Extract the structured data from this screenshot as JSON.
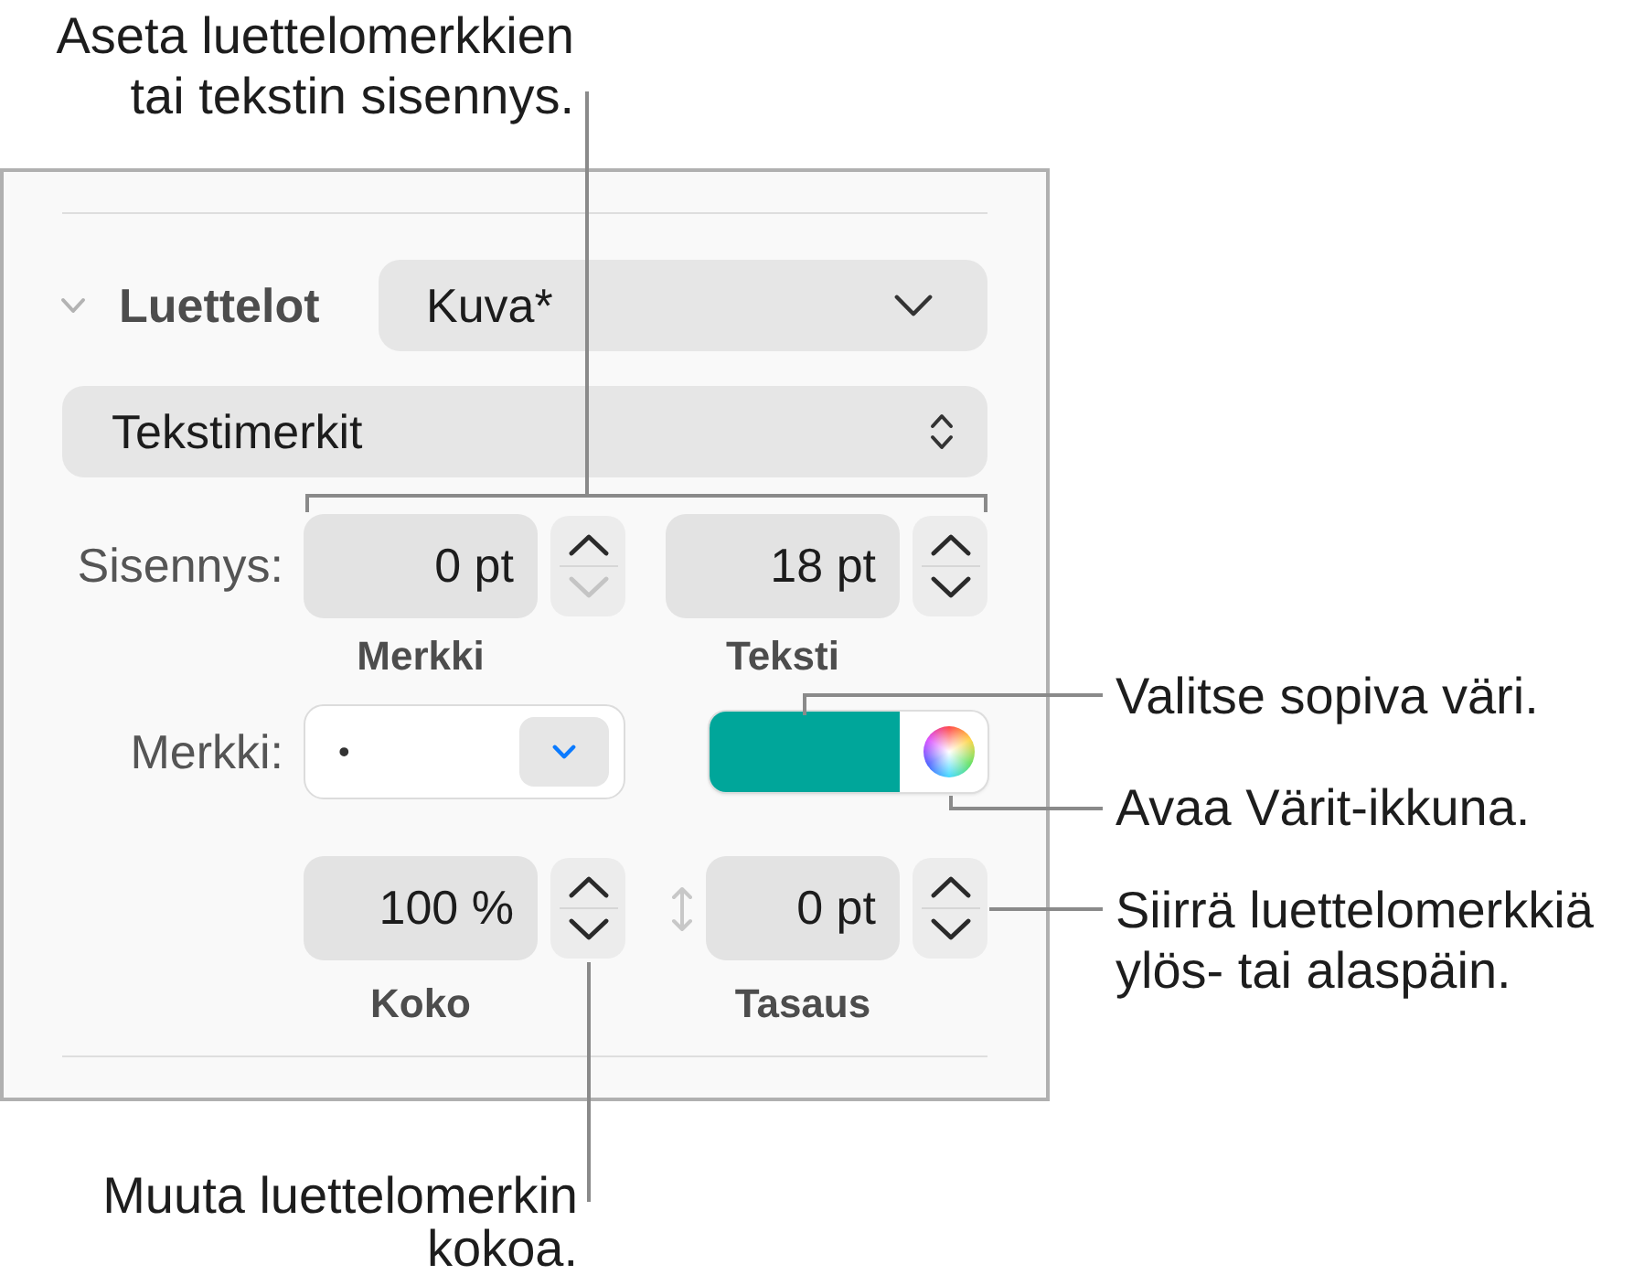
{
  "callouts": [
    {
      "text": "Aseta luettelomerkkien\ntai tekstin sisennys."
    },
    {
      "text": "Valitse sopiva väri."
    },
    {
      "text": "Avaa Värit-ikkuna."
    },
    {
      "text": "Siirrä luettelomerkkiä\nylös- tai alaspäin."
    },
    {
      "text": "Muuta luettelomerkin\nkokoa."
    }
  ],
  "panel": {
    "section": {
      "title": "Luettelot",
      "expanded": true
    },
    "list_style": {
      "value": "Kuva*"
    },
    "bullet_type": {
      "value": "Tekstimerkit"
    },
    "indent": {
      "label": "Sisennys:",
      "fields": [
        {
          "value": "0 pt",
          "caption": "Merkki",
          "decrement_disabled": true
        },
        {
          "value": "18 pt",
          "caption": "Teksti",
          "decrement_disabled": false
        }
      ]
    },
    "bullet": {
      "label": "Merkki:",
      "value": "•",
      "color": "#00a69a"
    },
    "size": {
      "value": "100 %",
      "caption": "Koko",
      "decrement_disabled": false
    },
    "alignment": {
      "value": "0 pt",
      "caption": "Tasaus",
      "decrement_disabled": false
    }
  }
}
